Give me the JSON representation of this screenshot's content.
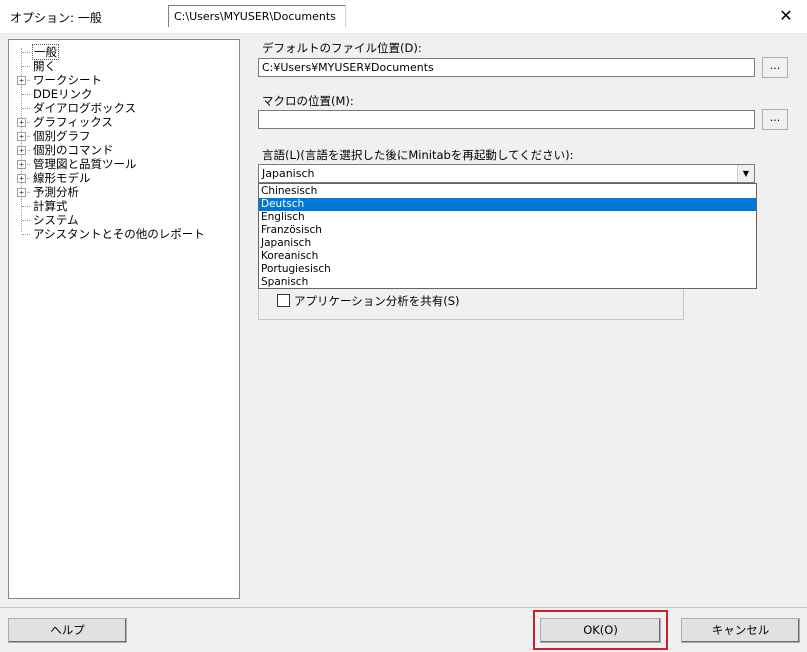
{
  "window": {
    "title": "オプション: 一般",
    "path_tab": "C:\\Users\\MYUSER\\Documents",
    "close_icon": "✕"
  },
  "tree": {
    "items": [
      {
        "label": "一般",
        "expandable": false,
        "selected": true
      },
      {
        "label": "開く",
        "expandable": false
      },
      {
        "label": "ワークシート",
        "expandable": true
      },
      {
        "label": "DDEリンク",
        "expandable": false
      },
      {
        "label": "ダイアログボックス",
        "expandable": false
      },
      {
        "label": "グラフィックス",
        "expandable": true
      },
      {
        "label": "個別グラフ",
        "expandable": true
      },
      {
        "label": "個別のコマンド",
        "expandable": true
      },
      {
        "label": "管理図と品質ツール",
        "expandable": true
      },
      {
        "label": "線形モデル",
        "expandable": true
      },
      {
        "label": "予測分析",
        "expandable": true
      },
      {
        "label": "計算式",
        "expandable": false
      },
      {
        "label": "システム",
        "expandable": false
      },
      {
        "label": "アシスタントとその他のレポート",
        "expandable": false
      }
    ]
  },
  "default_file": {
    "label": "デフォルトのファイル位置(D):",
    "value": "C:¥Users¥MYUSER¥Documents",
    "browse_label": "..."
  },
  "macro": {
    "label": "マクロの位置(M):",
    "value": "",
    "browse_label": "..."
  },
  "language": {
    "label": "言語(L)(言語を選択した後にMinitabを再起動してください):",
    "selected": "Japanisch",
    "arrow_icon": "▼",
    "options": [
      "Chinesisch",
      "Deutsch",
      "Englisch",
      "Französisch",
      "Japanisch",
      "Koreanisch",
      "Portugiesisch",
      "Spanisch"
    ],
    "highlighted_index": 1
  },
  "share": {
    "label": "アプリケーション分析を共有(S)",
    "checked": false
  },
  "buttons": {
    "help": "ヘルプ",
    "ok": "OK(O)",
    "cancel": "キャンセル"
  },
  "colors": {
    "highlight_box": "#d0202a",
    "selection": "#0078d7"
  }
}
